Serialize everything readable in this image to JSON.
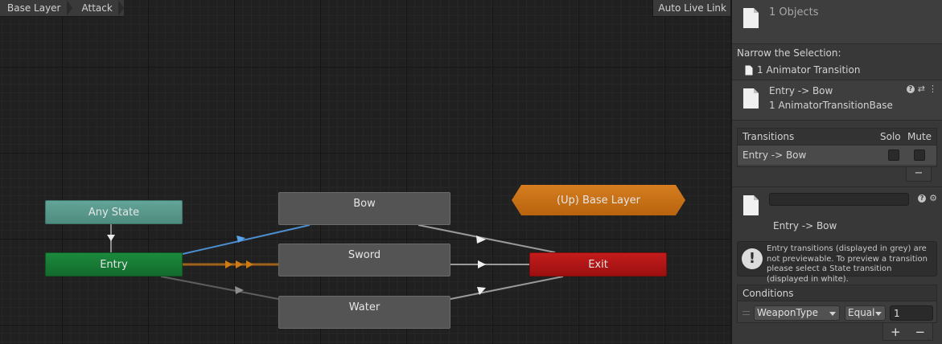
{
  "graph": {
    "breadcrumbs": [
      "Base Layer",
      "Attack"
    ],
    "live_link_label": "Auto Live Link",
    "nodes": {
      "any_state": "Any State",
      "entry": "Entry",
      "bow": "Bow",
      "sword": "Sword",
      "water": "Water",
      "exit": "Exit",
      "up_base_layer": "(Up) Base Layer"
    },
    "colors": {
      "any_state": "#5a9c8f",
      "entry": "#177a35",
      "state": "#545454",
      "exit": "#b01616",
      "up_layer": "#c87216",
      "transition_default": "#8c8c8c",
      "transition_selected": "#4c8ed0",
      "transition_preview": "#c07418"
    }
  },
  "inspector": {
    "object_count": "1 Objects",
    "narrow_title": "Narrow the Selection:",
    "narrow_item": "1 Animator Transition",
    "transition_name": "Entry -> Bow",
    "transition_type": "1 AnimatorTransitionBase",
    "transitions_list": {
      "header": "Transitions",
      "solo_label": "Solo",
      "mute_label": "Mute",
      "rows": [
        "Entry -> Bow"
      ],
      "remove_label": "−"
    },
    "name_field_value": "",
    "sub_transition_name": "Entry -> Bow",
    "info_text": "Entry transitions (displayed in grey) are not previewable. To preview a transition please select a State transition (displayed in white).",
    "info_icon": "!",
    "conditions": {
      "header": "Conditions",
      "parameter": "WeaponType",
      "mode": "Equal",
      "value": "1",
      "add_label": "+",
      "remove_label": "−"
    },
    "icons": {
      "help": "?",
      "presets": "⇄",
      "menu": "⋮",
      "settings": "⚙"
    }
  }
}
